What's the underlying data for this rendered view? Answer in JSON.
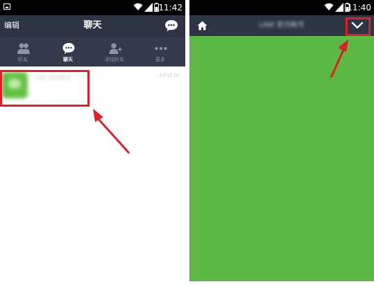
{
  "left_screen": {
    "status": {
      "time": "11:42"
    },
    "header": {
      "edit_label": "编辑",
      "title": "聊天"
    },
    "tabs": [
      {
        "label": "好友",
        "icon": "friends-icon",
        "active": false
      },
      {
        "label": "聊天",
        "icon": "chat-icon",
        "active": true
      },
      {
        "label": "添加好友",
        "icon": "add-friend-icon",
        "active": false
      },
      {
        "label": "更多",
        "icon": "more-icon",
        "active": false
      }
    ],
    "chat_list": [
      {
        "name": "LINE 官方帐号",
        "time": "上午11:30"
      }
    ]
  },
  "right_screen": {
    "status": {
      "time": "11:40"
    },
    "header": {
      "title": "LINE 官方帐号"
    },
    "icons": [
      "home-icon",
      "chevron-down-icon"
    ]
  },
  "colors": {
    "navbar": "#2e3444",
    "tabbar": "#343a4b",
    "chat_background": "#5cb944",
    "highlight": "#e21d27"
  }
}
